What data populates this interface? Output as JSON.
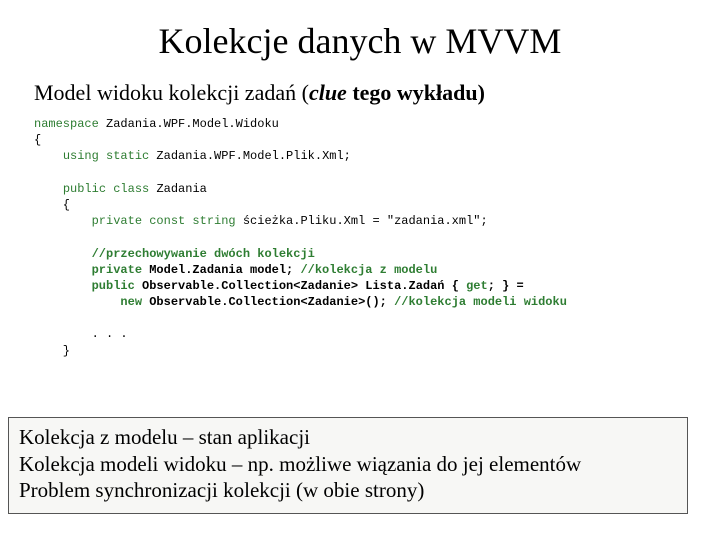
{
  "title": "Kolekcje danych w MVVM",
  "subtitle": {
    "pre": "Model widoku kolekcji zadań (",
    "clue": "clue",
    "post": " tego wykładu)"
  },
  "code": {
    "l1a": "namespace",
    "l1b": " Zadania.WPF.Model.Widoku",
    "l2": "{",
    "l3a": "    ",
    "l3b": "using static",
    "l3c": " Zadania.WPF.Model.Plik.Xml;",
    "l4": "",
    "l5a": "    ",
    "l5b": "public class ",
    "l5c": "Zadania",
    "l6": "    {",
    "l7a": "        ",
    "l7b": "private const string ",
    "l7c": "ścieżka.Pliku.Xml = \"zadania.xml\";",
    "l8": "",
    "l9a": "        ",
    "l9b": "//przechowywanie dwóch kolekcji",
    "l10a": "        ",
    "l10b": "private ",
    "l10c": "Model.Zadania model; ",
    "l10d": "//kolekcja z modelu",
    "l11a": "        ",
    "l11b": "public ",
    "l11c": "Observable.Collection<Zadanie> ",
    "l11d": "Lista.Zadań { ",
    "l11e": "get",
    "l11f": "; } =",
    "l12a": "            ",
    "l12b": "new ",
    "l12c": "Observable.Collection<Zadanie>(); ",
    "l12d": "//kolekcja modeli widoku",
    "l13": "",
    "l14": "        . . .",
    "l15": "    }"
  },
  "box": {
    "l1": "Kolekcja z modelu – stan aplikacji",
    "l2": "Kolekcja modeli widoku – np. możliwe wiązania do jej elementów",
    "l3": "Problem synchronizacji kolekcji (w obie strony)"
  }
}
